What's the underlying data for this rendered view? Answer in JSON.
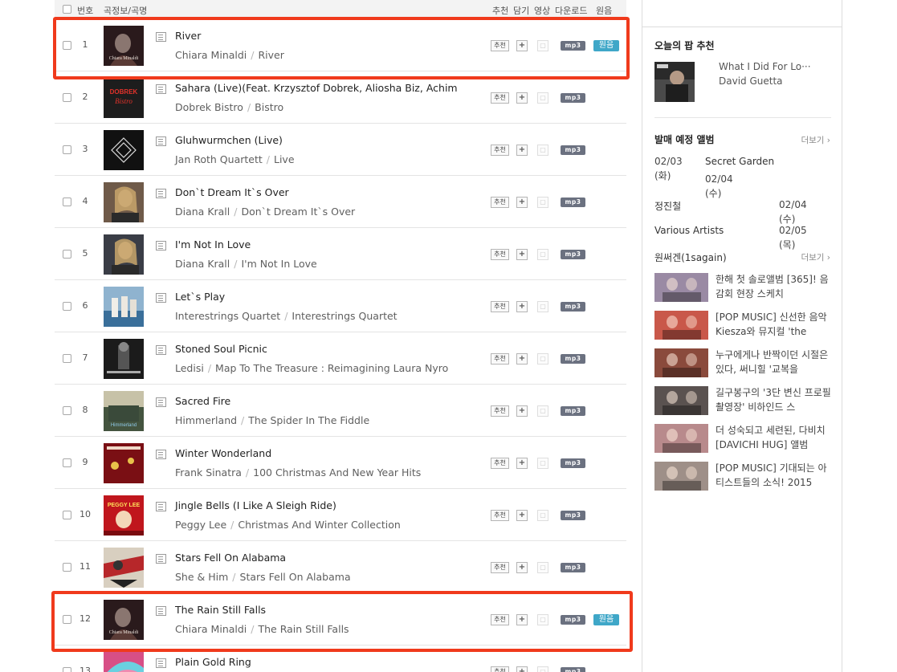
{
  "header": {
    "col_number": "번호",
    "col_song": "곡정보/곡명",
    "col_recommend": "추천",
    "col_add": "담기",
    "col_video": "영상",
    "col_download": "다운로드",
    "col_original": "원음"
  },
  "buttons": {
    "recommend": "추천",
    "add": "+",
    "video": "▢",
    "mp3": "mp3",
    "original": "원음"
  },
  "tracks": [
    {
      "num": "1",
      "title": "River",
      "artist": "Chiara Minaldi",
      "album": "River",
      "has_original": true
    },
    {
      "num": "2",
      "title": "Sahara (Live)(Feat. Krzysztof Dobrek, Aliosha Biz, Achim",
      "artist": "Dobrek Bistro",
      "album": "Bistro",
      "has_original": false
    },
    {
      "num": "3",
      "title": "Gluhwurmchen (Live)",
      "artist": "Jan Roth Quartett",
      "album": "Live",
      "has_original": false
    },
    {
      "num": "4",
      "title": "Don`t Dream It`s Over",
      "artist": "Diana Krall",
      "album": "Don`t Dream It`s Over",
      "has_original": false
    },
    {
      "num": "5",
      "title": "I'm Not In Love",
      "artist": "Diana Krall",
      "album": "I'm Not In Love",
      "has_original": false
    },
    {
      "num": "6",
      "title": "Let`s Play",
      "artist": "Interestrings Quartet",
      "album": "Interestrings Quartet",
      "has_original": false
    },
    {
      "num": "7",
      "title": "Stoned Soul Picnic",
      "artist": "Ledisi",
      "album": "Map To The Treasure : Reimagining Laura Nyro",
      "has_original": false
    },
    {
      "num": "8",
      "title": "Sacred Fire",
      "artist": "Himmerland",
      "album": "The Spider In The Fiddle",
      "has_original": false
    },
    {
      "num": "9",
      "title": "Winter Wonderland",
      "artist": "Frank Sinatra",
      "album": "100 Christmas And New Year Hits",
      "has_original": false
    },
    {
      "num": "10",
      "title": "Jingle Bells (I Like A Sleigh Ride)",
      "artist": "Peggy Lee",
      "album": "Christmas And Winter Collection",
      "has_original": false
    },
    {
      "num": "11",
      "title": "Stars Fell On Alabama",
      "artist": "She & Him",
      "album": "Stars Fell On Alabama",
      "has_original": false
    },
    {
      "num": "12",
      "title": "The Rain Still Falls",
      "artist": "Chiara Minaldi",
      "album": "The Rain Still Falls",
      "has_original": true
    },
    {
      "num": "13",
      "title": "Plain Gold Ring",
      "artist": "",
      "album": "",
      "has_original": false
    }
  ],
  "thumb_colors": [
    "#2a1a1c",
    "#1d1d1d",
    "#111111",
    "#6f5a49",
    "#3a3d46",
    "#8fb3cf",
    "#1b1b1b",
    "#44543f",
    "#7a0f14",
    "#c0161d",
    "#d8cfc0",
    "#2a1a1c",
    "#d74f86"
  ],
  "thumb_texts": {
    "t1": "Chiara Minaldi",
    "t2a": "DOBREK",
    "t2b": "Bistro",
    "t8": "Himmerland",
    "t10": "PEGGY LEE",
    "t12": "Chiara Minaldi"
  },
  "sidebar": {
    "pop_title": "오늘의 팝 추천",
    "pop_song": "What I Did For Lo···",
    "pop_artist": "David Guetta",
    "release_title": "발매 예정 앨범",
    "more": "더보기",
    "releases": [
      {
        "date1": "02/03",
        "day1": "(화)",
        "name1": "Secret Garden",
        "date2": "02/04",
        "day2": "(수)"
      },
      {
        "name": "정진철",
        "date": "02/04",
        "day": "(수)"
      },
      {
        "name": "Various Artists",
        "date": "02/05",
        "day": "(목)"
      }
    ],
    "related_title": "원써겐(1sagain)",
    "news": [
      {
        "text": "한해 첫 솔로앨범 [365]! 음감회 현장 스케치",
        "color": "#9a8aa4"
      },
      {
        "text": "[POP MUSIC] 신선한 음악 Kiesza와 뮤지컬 'the",
        "color": "#c9584a"
      },
      {
        "text": "누구에게나 반짝이던 시절은 있다, 써니힐 '교복을",
        "color": "#8a4a3c"
      },
      {
        "text": "길구봉구의 '3단 변신 프로필 촬영장' 비하인드 스",
        "color": "#5a5250"
      },
      {
        "text": "더 성숙되고 세련된, 다비치 [DAVICHI HUG] 앨범",
        "color": "#b88a8c"
      },
      {
        "text": "[POP MUSIC] 기대되는 아티스트들의 소식! 2015",
        "color": "#9e8f88"
      }
    ]
  }
}
